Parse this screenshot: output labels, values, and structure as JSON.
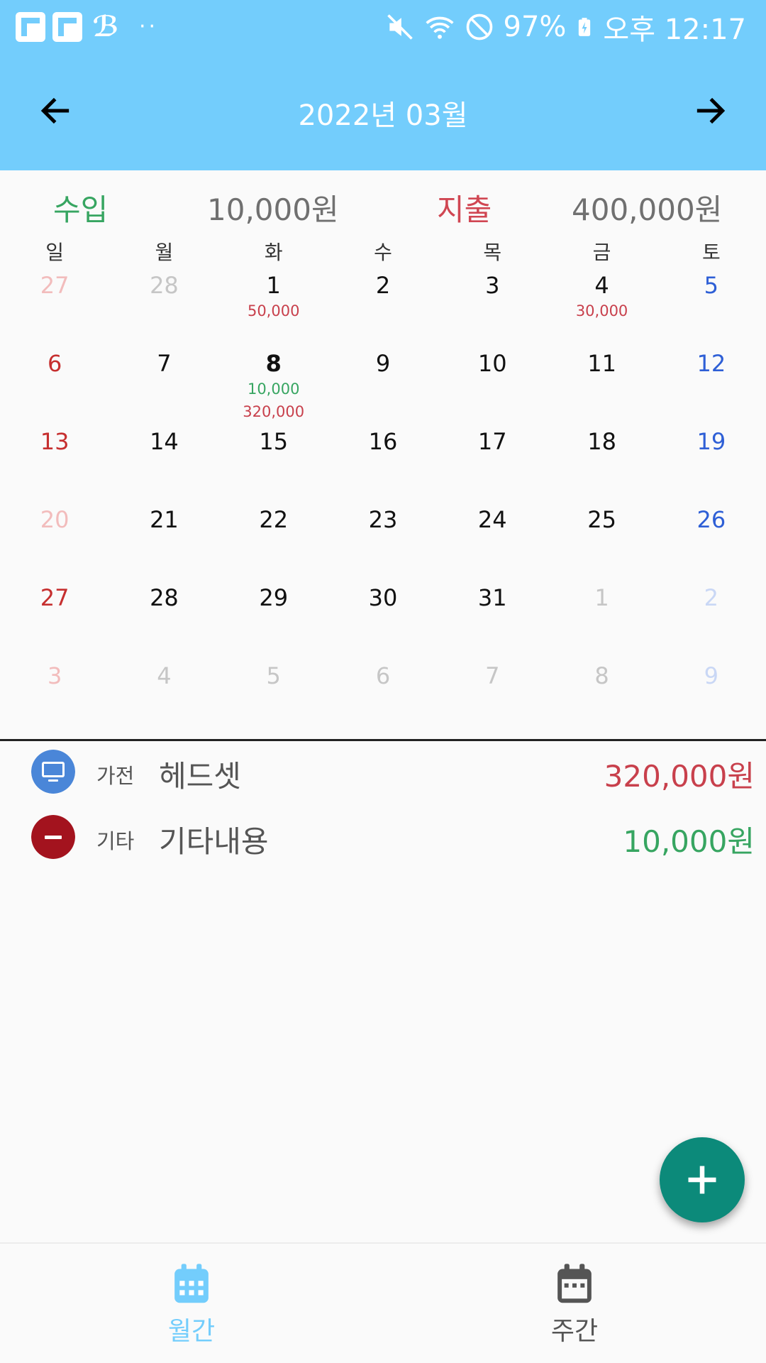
{
  "status_bar": {
    "battery": "97%",
    "time": "오후 12:17",
    "dots": "··"
  },
  "header": {
    "title": "2022년 03월"
  },
  "summary": {
    "income_label": "수입",
    "income_value": "10,000원",
    "expense_label": "지출",
    "expense_value": "400,000원"
  },
  "weekdays": [
    "일",
    "월",
    "화",
    "수",
    "목",
    "금",
    "토"
  ],
  "calendar": {
    "rows": [
      [
        {
          "day": "27",
          "kind": "sun-out"
        },
        {
          "day": "28",
          "kind": "out"
        },
        {
          "day": "1",
          "income": "",
          "expense": "50,000"
        },
        {
          "day": "2"
        },
        {
          "day": "3"
        },
        {
          "day": "4",
          "expense": "30,000"
        },
        {
          "day": "5",
          "kind": "sat"
        }
      ],
      [
        {
          "day": "6",
          "kind": "sun"
        },
        {
          "day": "7"
        },
        {
          "day": "8",
          "bold": true,
          "income": "10,000",
          "expense": "320,000"
        },
        {
          "day": "9"
        },
        {
          "day": "10"
        },
        {
          "day": "11"
        },
        {
          "day": "12",
          "kind": "sat"
        }
      ],
      [
        {
          "day": "13",
          "kind": "sun"
        },
        {
          "day": "14"
        },
        {
          "day": "15"
        },
        {
          "day": "16"
        },
        {
          "day": "17"
        },
        {
          "day": "18"
        },
        {
          "day": "19",
          "kind": "sat"
        }
      ],
      [
        {
          "day": "20",
          "kind": "sun-out"
        },
        {
          "day": "21"
        },
        {
          "day": "22"
        },
        {
          "day": "23"
        },
        {
          "day": "24"
        },
        {
          "day": "25"
        },
        {
          "day": "26",
          "kind": "sat"
        }
      ],
      [
        {
          "day": "27",
          "kind": "sun"
        },
        {
          "day": "28"
        },
        {
          "day": "29"
        },
        {
          "day": "30"
        },
        {
          "day": "31"
        },
        {
          "day": "1",
          "kind": "out"
        },
        {
          "day": "2",
          "kind": "sat-out"
        }
      ],
      [
        {
          "day": "3",
          "kind": "sun-out"
        },
        {
          "day": "4",
          "kind": "out"
        },
        {
          "day": "5",
          "kind": "out"
        },
        {
          "day": "6",
          "kind": "out"
        },
        {
          "day": "7",
          "kind": "out"
        },
        {
          "day": "8",
          "kind": "out"
        },
        {
          "day": "9",
          "kind": "sat-out"
        }
      ]
    ]
  },
  "transactions": [
    {
      "icon": "monitor-icon",
      "icon_color": "#4a86d8",
      "category": "가전",
      "title": "헤드셋",
      "amount": "320,000원",
      "type": "expense"
    },
    {
      "icon": "minus-circle-icon",
      "icon_color": "#a3131e",
      "category": "기타",
      "title": "기타내용",
      "amount": "10,000원",
      "type": "income"
    }
  ],
  "bottom_nav": {
    "monthly_label": "월간",
    "weekly_label": "주간"
  },
  "colors": {
    "primary": "#73cdfc",
    "income": "#37a561",
    "expense": "#c8404c",
    "fab": "#0c8a7a"
  }
}
